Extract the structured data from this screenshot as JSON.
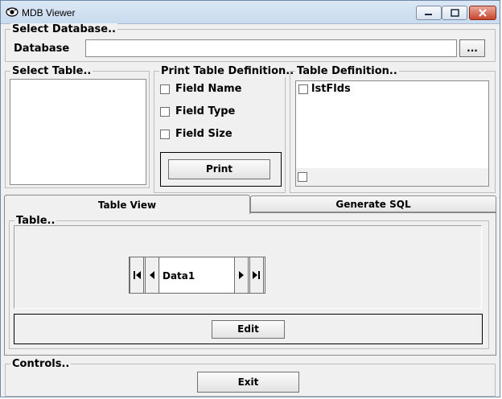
{
  "window": {
    "title": "MDB Viewer"
  },
  "select_database": {
    "group_label": "Select Database..",
    "database_label": "Database",
    "database_value": "",
    "browse_label": "..."
  },
  "select_table": {
    "group_label": "Select Table..",
    "items": []
  },
  "print_table_definition": {
    "group_label": "Print Table Definition..",
    "options": [
      {
        "label": "Field Name",
        "checked": false
      },
      {
        "label": "Field Type",
        "checked": false
      },
      {
        "label": "Field Size",
        "checked": false
      }
    ],
    "print_label": "Print"
  },
  "table_definition": {
    "group_label": "Table Definition..",
    "list_item": "lstFlds"
  },
  "tabs": [
    {
      "label": "Table View",
      "active": true
    },
    {
      "label": "Generate SQL",
      "active": false
    }
  ],
  "table_view": {
    "group_label": "Table..",
    "data_control_caption": "Data1",
    "edit_label": "Edit"
  },
  "controls": {
    "group_label": "Controls..",
    "exit_label": "Exit"
  }
}
